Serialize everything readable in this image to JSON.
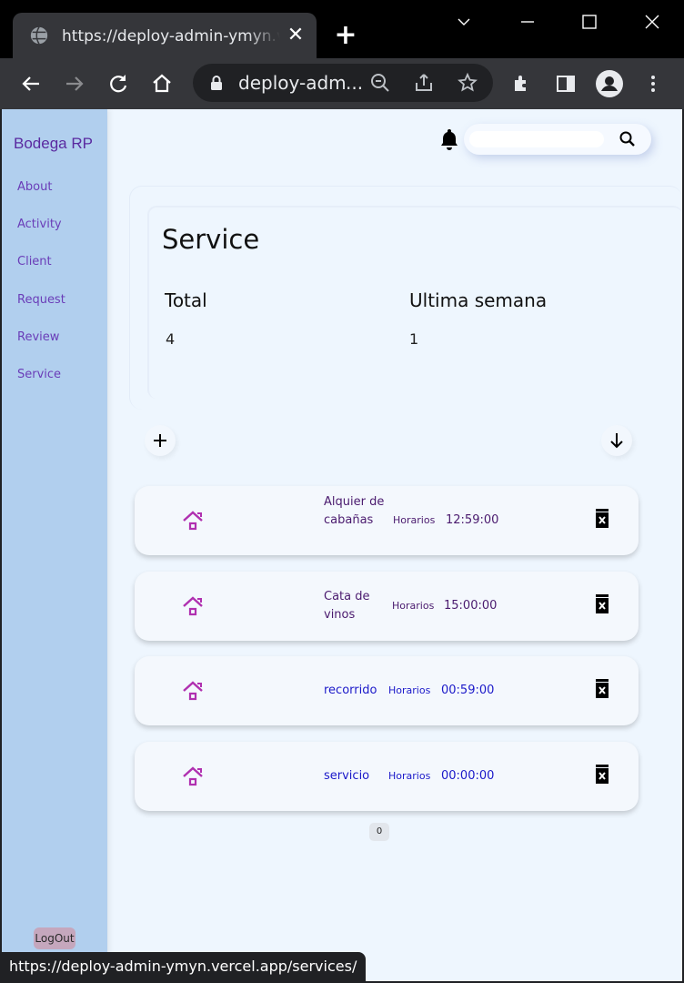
{
  "browser": {
    "tab_title": "https://deploy-admin-ymyn.vercel.app/services/",
    "omnibox_text": "deploy-admin-ymyn.vercel.app/services/",
    "status_url": "https://deploy-admin-ymyn.vercel.app/services/"
  },
  "sidebar": {
    "brand": "Bodega RP",
    "items": [
      {
        "label": "About"
      },
      {
        "label": "Activity"
      },
      {
        "label": "Client"
      },
      {
        "label": "Request"
      },
      {
        "label": "Review"
      },
      {
        "label": "Service"
      }
    ],
    "logout_label": "LogOut"
  },
  "header": {
    "search_placeholder": ""
  },
  "summary": {
    "title": "Service",
    "total_label": "Total",
    "total_value": "4",
    "week_label": "Ultima semana",
    "week_value": "1"
  },
  "services": [
    {
      "name": "Alquier de cabañas",
      "hours_label": "Horarios",
      "time": "12:59:00",
      "color": "#4a1a6e"
    },
    {
      "name": "Cata de vinos",
      "hours_label": "Horarios",
      "time": "15:00:00",
      "color": "#4a1a6e"
    },
    {
      "name": "recorrido",
      "hours_label": "Horarios",
      "time": "00:59:00",
      "color": "#1b19c9"
    },
    {
      "name": "servicio",
      "hours_label": "Horarios",
      "time": "00:00:00",
      "color": "#1b19c9"
    }
  ],
  "pagination": {
    "page": "0"
  },
  "colors": {
    "sidebar_bg": "#b1cfee",
    "page_bg": "#eef6fe",
    "accent_icon": "#b030b0"
  }
}
